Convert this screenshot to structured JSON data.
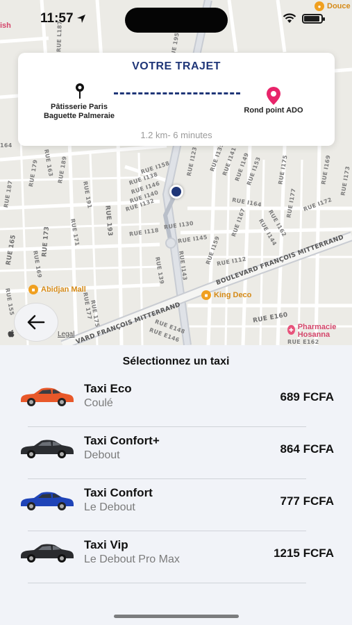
{
  "status_bar": {
    "time": "11:57"
  },
  "trip": {
    "title": "VOTRE TRAJET",
    "from": "Pâtisserie Paris Baguette Palmeraie",
    "to": "Rond point ADO",
    "info": "1.2 km- 6 minutes",
    "dash_color": "#1f3678",
    "dest_pin_color": "#e8246a"
  },
  "map": {
    "streets": [
      "RUE L187",
      "RUE 195",
      "RUE I123",
      "RUE I158",
      "RUE I138",
      "RUE I146",
      "RUE I140",
      "RUE I132",
      "RUE I135",
      "RUE I141",
      "RUE I149",
      "RUE I153",
      "RUE I130",
      "RUE I118",
      "RUE I145",
      "RUE I143",
      "RUE I164",
      "RUE I167",
      "RUE I162",
      "RUE I144",
      "RUE I172",
      "RUE I159",
      "RUE I112",
      "RUE 193",
      "RUE 173",
      "RUE 165",
      "RUE 189",
      "RUE 179",
      "RUE 187",
      "RUE 191",
      "RUE 169",
      "RUE 163",
      "RUE 177",
      "RUE 175",
      "RUE 155",
      "RUE E160",
      "RUE E146",
      "RUE E148",
      "RUE E162",
      "RUE 139",
      "RUE 171",
      "RUE I175",
      "RUE I177",
      "RUE I169",
      "RUE I173",
      "BOULEVARD FRANÇOIS MITTERRAND",
      "VARD FRANÇOIS MITTERRAND"
    ],
    "pois": {
      "top_right": "Douce",
      "top_left": "ish",
      "abidjan_mall": "Abidjan Mall",
      "king_deco": "King Deco",
      "pharmacie": "Pharmacie Hosanna"
    },
    "legal": "Legal",
    "edge_label": "164"
  },
  "sheet": {
    "title": "Sélectionnez un taxi",
    "taxis": [
      {
        "name": "Taxi Eco",
        "subtitle": "Coulé",
        "price": "689 FCFA",
        "car_color": "#e8582a"
      },
      {
        "name": "Taxi Confort+",
        "subtitle": "Debout",
        "price": "864 FCFA",
        "car_color": "#2b2d31"
      },
      {
        "name": "Taxi Confort",
        "subtitle": "Le Debout",
        "price": "777 FCFA",
        "car_color": "#1f44b8"
      },
      {
        "name": "Taxi Vip",
        "subtitle": "Le Debout Pro Max",
        "price": "1215 FCFA",
        "car_color": "#2a2b2e"
      }
    ]
  }
}
